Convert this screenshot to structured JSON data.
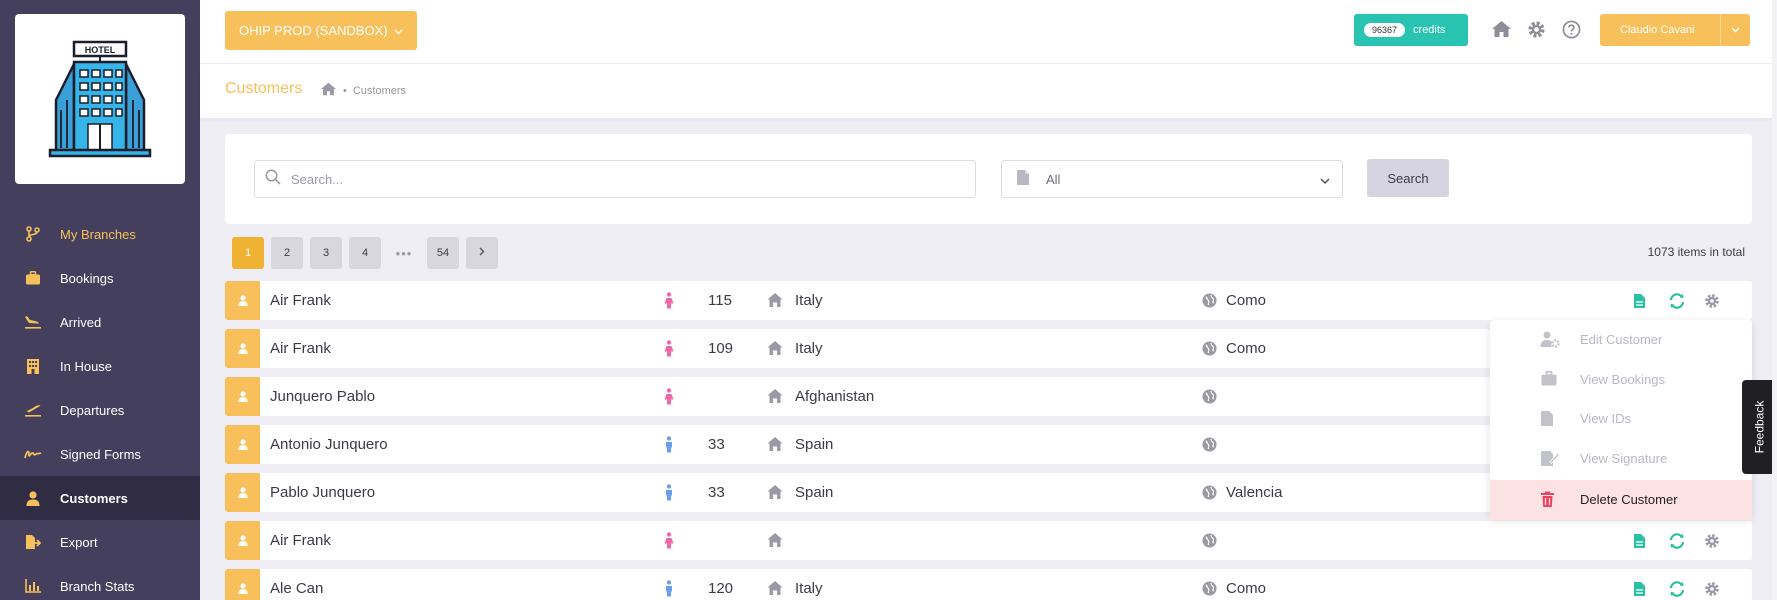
{
  "logo": {
    "sign_text": "HOTEL"
  },
  "sidebar": {
    "items": [
      {
        "label": "My Branches",
        "icon": "branch-icon"
      },
      {
        "label": "Bookings",
        "icon": "briefcase-icon"
      },
      {
        "label": "Arrived",
        "icon": "plane-landing-icon"
      },
      {
        "label": "In House",
        "icon": "building-icon"
      },
      {
        "label": "Departures",
        "icon": "plane-departure-icon"
      },
      {
        "label": "Signed Forms",
        "icon": "signature-icon"
      },
      {
        "label": "Customers",
        "icon": "user-icon"
      },
      {
        "label": "Export",
        "icon": "file-export-icon"
      },
      {
        "label": "Branch Stats",
        "icon": "bar-chart-icon"
      }
    ]
  },
  "topbar": {
    "property": "OHIP PROD (SANDBOX)",
    "credits_count": "96367",
    "credits_label": "credits",
    "user_name": "Claudio Cavani"
  },
  "header": {
    "title": "Customers",
    "breadcrumb": "Customers"
  },
  "search": {
    "placeholder": "Search...",
    "filter_value": "All",
    "button": "Search"
  },
  "pagination": {
    "pages": [
      "1",
      "2",
      "3",
      "4",
      "54"
    ],
    "dots": "•••",
    "active": "1",
    "total": "1073 items in total"
  },
  "customers": [
    {
      "name": "Air Frank",
      "gender": "female",
      "age": "115",
      "country": "Italy",
      "city": "Como"
    },
    {
      "name": "Air Frank",
      "gender": "female",
      "age": "109",
      "country": "Italy",
      "city": "Como"
    },
    {
      "name": "Junquero Pablo",
      "gender": "female",
      "age": "",
      "country": "Afghanistan",
      "city": ""
    },
    {
      "name": "Antonio Junquero",
      "gender": "male",
      "age": "33",
      "country": "Spain",
      "city": ""
    },
    {
      "name": "Pablo Junquero",
      "gender": "male",
      "age": "33",
      "country": "Spain",
      "city": "Valencia"
    },
    {
      "name": "Air Frank",
      "gender": "female",
      "age": "",
      "country": "",
      "city": ""
    },
    {
      "name": "Ale Can",
      "gender": "male",
      "age": "120",
      "country": "Italy",
      "city": "Como"
    }
  ],
  "menu": {
    "items": [
      {
        "label": "Edit Customer",
        "icon": "user-gear-icon"
      },
      {
        "label": "View Bookings",
        "icon": "briefcase-icon"
      },
      {
        "label": "View IDs",
        "icon": "file-icon"
      },
      {
        "label": "View Signature",
        "icon": "signature-icon"
      },
      {
        "label": "Delete Customer",
        "icon": "trash-icon"
      }
    ]
  },
  "feedback": "Feedback",
  "colors": {
    "accent": "#f7c05a",
    "sidebar": "#433f5c",
    "teal": "#29c4b1",
    "danger": "#e94560",
    "female": "#f06aa7",
    "male": "#6c9fe8"
  }
}
